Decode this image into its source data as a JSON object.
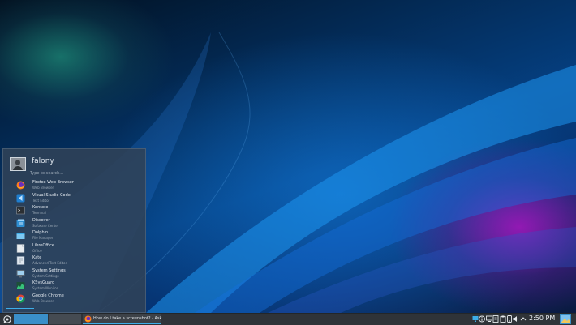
{
  "launcher": {
    "user_name": "falony",
    "search_placeholder": "Type to search...",
    "apps": [
      {
        "name": "Firefox Web Browser",
        "desc": "Web Browser",
        "icon": "firefox-icon"
      },
      {
        "name": "Visual Studio Code",
        "desc": "Text Editor",
        "icon": "vscode-icon"
      },
      {
        "name": "Konsole",
        "desc": "Terminal",
        "icon": "konsole-icon"
      },
      {
        "name": "Discover",
        "desc": "Software Center",
        "icon": "discover-icon"
      },
      {
        "name": "Dolphin",
        "desc": "File Manager",
        "icon": "dolphin-icon"
      },
      {
        "name": "LibreOffice",
        "desc": "Office",
        "icon": "libreoffice-icon"
      },
      {
        "name": "Kate",
        "desc": "Advanced Text Editor",
        "icon": "kate-icon"
      },
      {
        "name": "System Settings",
        "desc": "System Settings",
        "icon": "settings-icon"
      },
      {
        "name": "KSysGuard",
        "desc": "System Monitor",
        "icon": "ksysguard-icon"
      },
      {
        "name": "Google Chrome",
        "desc": "Web Browser",
        "icon": "chrome-icon"
      }
    ]
  },
  "taskbar": {
    "task_label": "How do I take a screenshot? - Ask ...",
    "clock": "2:50 PM",
    "tray_icons": [
      "display-icon",
      "info-icon",
      "network-icon",
      "notes-icon",
      "clipboard-icon",
      "device-icon",
      "volume-icon",
      "expand-tray-icon"
    ]
  },
  "colors": {
    "accent": "#3daee9",
    "panel": "#2f3338",
    "launcher": "#304258"
  }
}
